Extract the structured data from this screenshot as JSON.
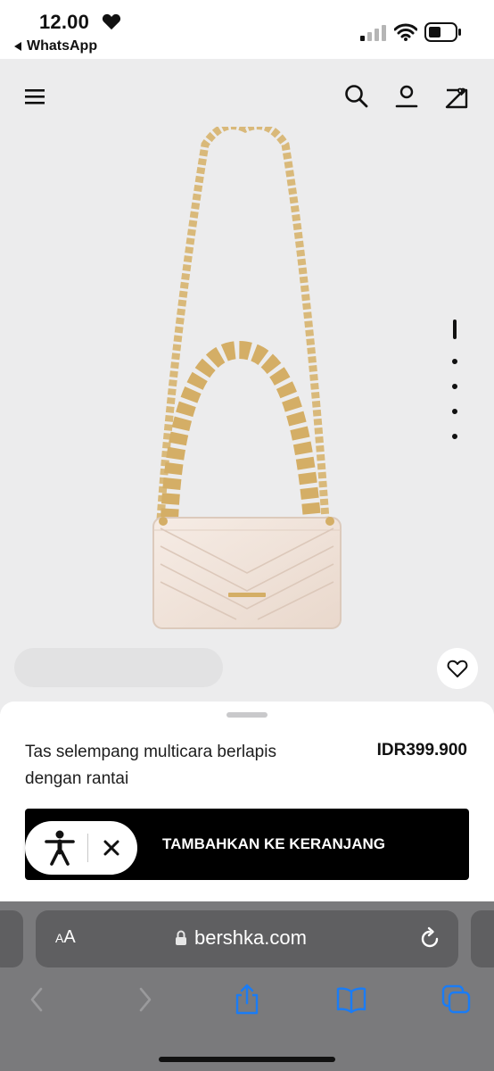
{
  "status_bar": {
    "time": "12.00",
    "back_app": "WhatsApp"
  },
  "nav": {
    "menu_icon": "hamburger-menu-icon",
    "search_icon": "search-icon",
    "account_icon": "user-icon",
    "wishlist_icon": "bag-heart-icon"
  },
  "gallery": {
    "image_count": 5,
    "active_index": 1
  },
  "product": {
    "name": "Tas selempang multicara berlapis dengan rantai",
    "price": "IDR399.900",
    "add_to_cart_label": "TAMBAHKAN KE KERANJANG"
  },
  "browser": {
    "text_size_label_small": "A",
    "text_size_label_large": "A",
    "url": "bershka.com"
  },
  "colors": {
    "product_bg": "#ececed",
    "cta": "#000000",
    "safari_bar": "#7a7a7c",
    "safari_accent": "#1a7cf5",
    "gold_chain": "#d9b97a",
    "bag_body": "#f3e6dd"
  }
}
